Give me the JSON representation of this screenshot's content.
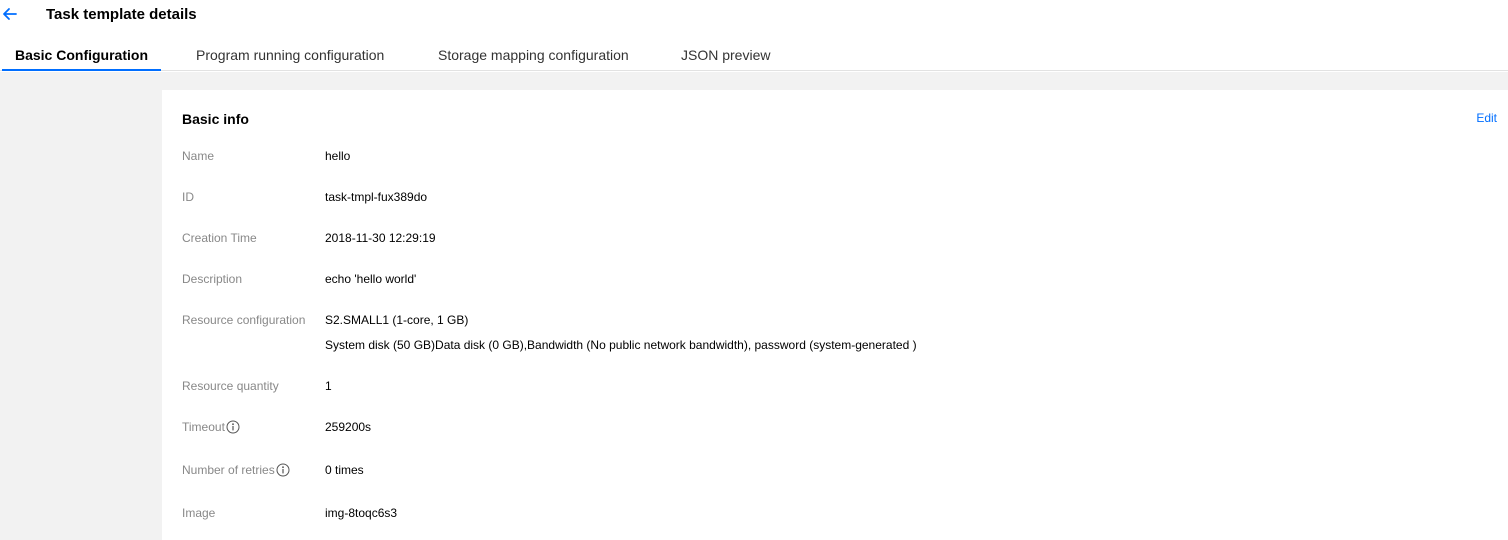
{
  "header": {
    "title": "Task template details"
  },
  "tabs": [
    {
      "label": "Basic Configuration",
      "active": true
    },
    {
      "label": "Program running configuration",
      "active": false
    },
    {
      "label": "Storage mapping configuration",
      "active": false
    },
    {
      "label": "JSON preview",
      "active": false
    }
  ],
  "basic_info": {
    "title": "Basic info",
    "edit_label": "Edit",
    "fields": {
      "name": {
        "label": "Name",
        "value": "hello"
      },
      "id": {
        "label": "ID",
        "value": "task-tmpl-fux389do"
      },
      "creation_time": {
        "label": "Creation Time",
        "value": "2018-11-30 12:29:19"
      },
      "description": {
        "label": "Description",
        "value": "echo 'hello world'"
      },
      "resource_configuration": {
        "label": "Resource configuration",
        "value": "S2.SMALL1 (1-core, 1 GB)",
        "value_line2": "System disk (50 GB)Data disk (0 GB),Bandwidth (No public network bandwidth), password (system-generated )"
      },
      "resource_quantity": {
        "label": "Resource quantity",
        "value": "1"
      },
      "timeout": {
        "label": "Timeout",
        "value": "259200s"
      },
      "retries": {
        "label": "Number of retries",
        "value": "0 times"
      },
      "image": {
        "label": "Image",
        "value": "img-8toqc6s3"
      }
    }
  },
  "colors": {
    "accent": "#006eff",
    "label": "#888888",
    "background": "#f2f2f2"
  },
  "icons": {
    "back": "arrow-left-icon",
    "info": "info-circle-icon"
  }
}
